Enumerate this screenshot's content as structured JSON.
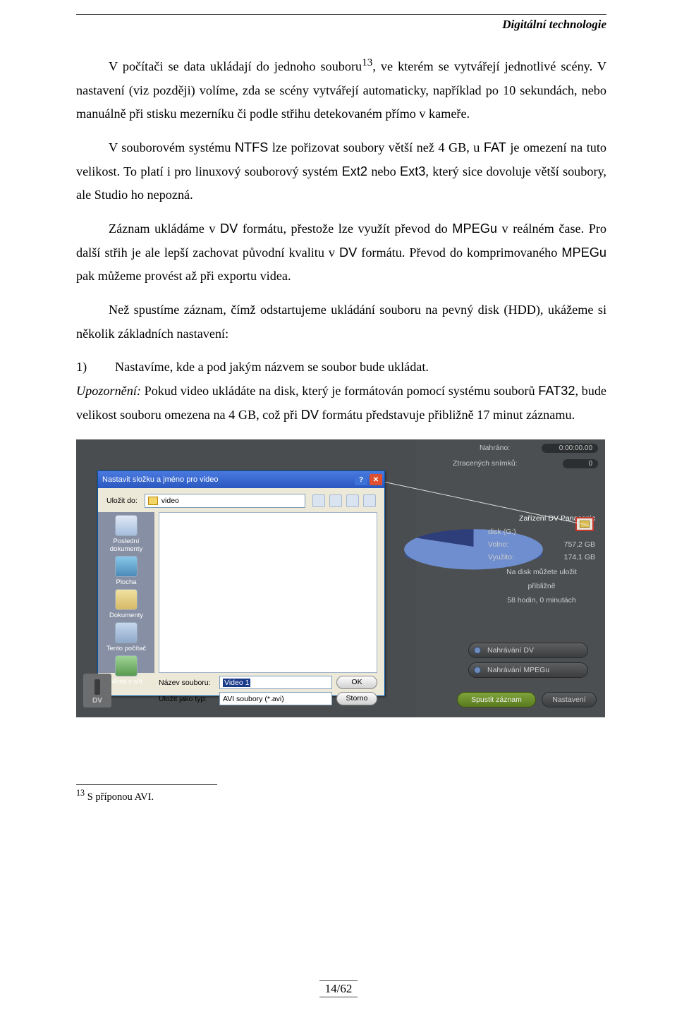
{
  "header": {
    "title": "Digitální technologie"
  },
  "p1a": "V počítači se data ukládají do jednoho souboru",
  "p1sup": "13",
  "p1b": ", ve kterém se vytvářejí jednotlivé scény. V nastavení (viz později) volíme, zda se scény vytvářejí automaticky, například po 10 sekundách, nebo manuálně při stisku mezerníku či podle střihu detekovaném přímo v kameře.",
  "p2a": "V souborovém systému ",
  "p2b": "NTFS",
  "p2c": " lze pořizovat soubory větší než 4 GB, u ",
  "p2d": "FAT",
  "p2e": " je omezení na tuto velikost. To platí i pro linuxový souborový systém ",
  "p2f": "Ext2",
  "p2g": " nebo ",
  "p2h": "Ext3",
  "p2i": ", který sice dovoluje větší soubory, ale Studio ho nepozná.",
  "p3a": "Záznam ukládáme v ",
  "p3b": "DV",
  "p3c": " formátu, přestože lze využít převod do ",
  "p3d": "MPEGu",
  "p3e": " v reálném čase. Pro další střih je ale lepší zachovat původní kvalitu v ",
  "p3f": "DV",
  "p3g": " formátu. Převod do komprimovaného ",
  "p3h": "MPEGu",
  "p3i": " pak můžeme provést až při exportu videa.",
  "p4": "Než spustíme záznam, čímž odstartujeme ukládání souboru na pevný disk (HDD), ukážeme si několik základních nastavení:",
  "item1_num": "1)",
  "item1_text": "Nastavíme, kde a pod jakým názvem se soubor bude ukládat.",
  "upoz_label": "Upozornění:",
  "upoz_a": " Pokud video ukládáte na disk, který je formátován pomocí systému souborů ",
  "upoz_b": "FAT32",
  "upoz_c": ", bude velikost souboru omezena na 4 GB, což při ",
  "upoz_d": "DV",
  "upoz_e": " formátu představuje přibližně 17 minut záznamu.",
  "dialog": {
    "title": "Nastavit složku a jméno pro video",
    "save_in_label": "Uložit do:",
    "save_in_value": "video",
    "sidebar": [
      "Poslední\ndokumenty",
      "Plocha",
      "Dokumenty",
      "Tento počítač",
      "Místa v síti"
    ],
    "name_label": "Název souboru:",
    "name_value": "Video 1",
    "type_label": "Uložit jako typ:",
    "type_value": "AVI soubory (*.avi)",
    "ok": "OK",
    "cancel": "Storno"
  },
  "right": {
    "rec_label": "Nahráno:",
    "rec_value": "0:00:00.00",
    "drop_label": "Ztracených snímků:",
    "drop_value": "0",
    "device": "Zařízení DV Panasonic",
    "disk_label": "disk (G:)",
    "free_label": "Volno:",
    "free_value": "757,2 GB",
    "used_label": "Využito:",
    "used_value": "174,1 GB",
    "note1": "Na disk můžete uložit",
    "note2": "přibližně",
    "note3": "58 hodin, 0 minutách",
    "rec_dv": "Nahrávání DV",
    "rec_mpeg": "Nahrávání MPEGu",
    "start": "Spustit záznam",
    "settings": "Nastavení"
  },
  "dv_label": "DV",
  "footnote_num": "13",
  "footnote_text": " S příponou AVI.",
  "page": "14/62"
}
